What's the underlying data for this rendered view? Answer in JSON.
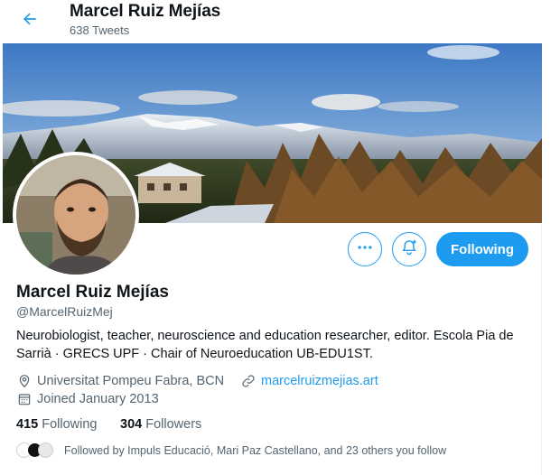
{
  "header": {
    "name": "Marcel Ruiz Mejías",
    "tweet_count": "638 Tweets"
  },
  "actions": {
    "following_label": "Following"
  },
  "profile": {
    "name": "Marcel Ruiz Mejías",
    "handle": "@MarcelRuizMej",
    "bio": "Neurobiologist, teacher, neuroscience and education researcher, editor. Escola Pia de Sarrià · GRECS UPF · Chair of Neuroeducation UB-EDU1ST.",
    "location": "Universitat Pompeu Fabra, BCN",
    "website": "marcelruizmejias.art",
    "joined": "Joined January 2013"
  },
  "stats": {
    "following_count": "415",
    "following_label": "Following",
    "followers_count": "304",
    "followers_label": "Followers"
  },
  "followed_by": "Followed by Impuls Educació, Mari Paz Castellano, and 23 others you follow",
  "colors": {
    "accent": "#1d9bf0",
    "text": "#0f1419",
    "muted": "#536471"
  },
  "icons": {
    "back": "arrow-left-icon",
    "more": "more-dots-icon",
    "notify": "bell-plus-icon",
    "location": "location-pin-icon",
    "link": "link-icon",
    "calendar": "calendar-icon"
  }
}
